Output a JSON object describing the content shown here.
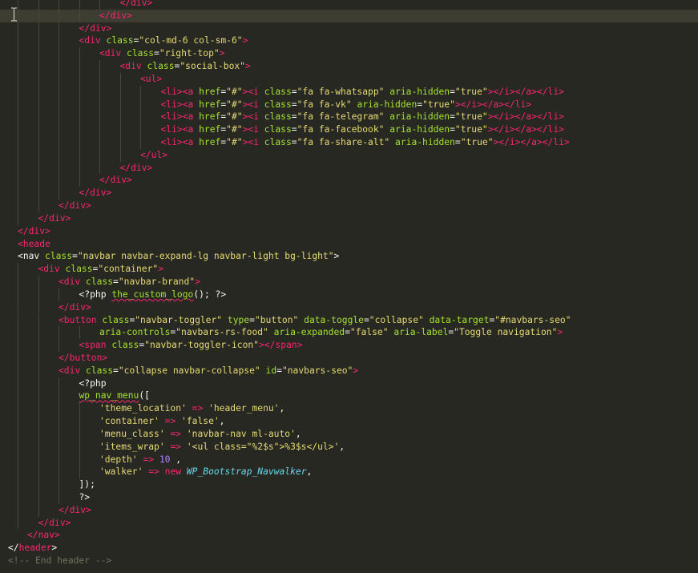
{
  "editor": {
    "theme": "monokai",
    "background": "#272822",
    "current_line_background": "#3e3d32",
    "current_line": 1,
    "colors": {
      "tag": "#f92672",
      "attr": "#a6e22e",
      "string": "#e6db74",
      "number": "#ae81ff",
      "class_name": "#66d9ef",
      "comment": "#75715e",
      "plain": "#f8f8f2"
    },
    "cursor_icon": "text-cursor-icon"
  },
  "lines": [
    {
      "indent": 5,
      "tokens": [
        [
          "tag",
          "</div>"
        ]
      ]
    },
    {
      "indent": 4,
      "tokens": [
        [
          "tag",
          "</div>"
        ]
      ]
    },
    {
      "indent": 3,
      "tokens": [
        [
          "tag",
          "</div>"
        ]
      ]
    },
    {
      "indent": 3,
      "tokens": [
        [
          "tag",
          "<div"
        ],
        [
          "plain",
          " "
        ],
        [
          "attr",
          "class"
        ],
        [
          "plain",
          "="
        ],
        [
          "str",
          "\"col-md-6 col-sm-6\""
        ],
        [
          "tag",
          ">"
        ]
      ]
    },
    {
      "indent": 4,
      "tokens": [
        [
          "tag",
          "<div"
        ],
        [
          "plain",
          " "
        ],
        [
          "attr",
          "class"
        ],
        [
          "plain",
          "="
        ],
        [
          "str",
          "\"right-top\""
        ],
        [
          "tag",
          ">"
        ]
      ]
    },
    {
      "indent": 5,
      "tokens": [
        [
          "tag",
          "<div"
        ],
        [
          "plain",
          " "
        ],
        [
          "attr",
          "class"
        ],
        [
          "plain",
          "="
        ],
        [
          "str",
          "\"social-box\""
        ],
        [
          "tag",
          ">"
        ]
      ]
    },
    {
      "indent": 6,
      "tokens": [
        [
          "tag",
          "<ul>"
        ]
      ]
    },
    {
      "indent": 7,
      "tokens": [
        [
          "tag",
          "<li><a"
        ],
        [
          "plain",
          " "
        ],
        [
          "attr",
          "href"
        ],
        [
          "plain",
          "="
        ],
        [
          "str",
          "\"#\""
        ],
        [
          "tag",
          "><i"
        ],
        [
          "plain",
          " "
        ],
        [
          "attr",
          "class"
        ],
        [
          "plain",
          "="
        ],
        [
          "str",
          "\"fa fa-whatsapp\""
        ],
        [
          "plain",
          " "
        ],
        [
          "attr",
          "aria-hidden"
        ],
        [
          "plain",
          "="
        ],
        [
          "str",
          "\"true\""
        ],
        [
          "tag",
          "></i></a></li>"
        ]
      ]
    },
    {
      "indent": 7,
      "tokens": [
        [
          "tag",
          "<li><a"
        ],
        [
          "plain",
          " "
        ],
        [
          "attr",
          "href"
        ],
        [
          "plain",
          "="
        ],
        [
          "str",
          "\"#\""
        ],
        [
          "tag",
          "><i"
        ],
        [
          "plain",
          " "
        ],
        [
          "attr",
          "class"
        ],
        [
          "plain",
          "="
        ],
        [
          "str",
          "\"fa fa-vk\""
        ],
        [
          "plain",
          " "
        ],
        [
          "attr",
          "aria-hidden"
        ],
        [
          "plain",
          "="
        ],
        [
          "str",
          "\"true\""
        ],
        [
          "tag",
          "></i></a></li>"
        ]
      ]
    },
    {
      "indent": 7,
      "tokens": [
        [
          "tag",
          "<li><a"
        ],
        [
          "plain",
          " "
        ],
        [
          "attr",
          "href"
        ],
        [
          "plain",
          "="
        ],
        [
          "str",
          "\"#\""
        ],
        [
          "tag",
          "><i"
        ],
        [
          "plain",
          " "
        ],
        [
          "attr",
          "class"
        ],
        [
          "plain",
          "="
        ],
        [
          "str",
          "\"fa fa-telegram\""
        ],
        [
          "plain",
          " "
        ],
        [
          "attr",
          "aria-hidden"
        ],
        [
          "plain",
          "="
        ],
        [
          "str",
          "\"true\""
        ],
        [
          "tag",
          "></i></a></li>"
        ]
      ]
    },
    {
      "indent": 7,
      "tokens": [
        [
          "tag",
          "<li><a"
        ],
        [
          "plain",
          " "
        ],
        [
          "attr",
          "href"
        ],
        [
          "plain",
          "="
        ],
        [
          "str",
          "\"#\""
        ],
        [
          "tag",
          "><i"
        ],
        [
          "plain",
          " "
        ],
        [
          "attr",
          "class"
        ],
        [
          "plain",
          "="
        ],
        [
          "str",
          "\"fa fa-facebook\""
        ],
        [
          "plain",
          " "
        ],
        [
          "attr",
          "aria-hidden"
        ],
        [
          "plain",
          "="
        ],
        [
          "str",
          "\"true\""
        ],
        [
          "tag",
          "></i></a></li>"
        ]
      ]
    },
    {
      "indent": 7,
      "tokens": [
        [
          "tag",
          "<li><a"
        ],
        [
          "plain",
          " "
        ],
        [
          "attr",
          "href"
        ],
        [
          "plain",
          "="
        ],
        [
          "str",
          "\"#\""
        ],
        [
          "tag",
          "><i"
        ],
        [
          "plain",
          " "
        ],
        [
          "attr",
          "class"
        ],
        [
          "plain",
          "="
        ],
        [
          "str",
          "\"fa fa-share-alt\""
        ],
        [
          "plain",
          " "
        ],
        [
          "attr",
          "aria-hidden"
        ],
        [
          "plain",
          "="
        ],
        [
          "str",
          "\"true\""
        ],
        [
          "tag",
          "></i></a></li>"
        ]
      ]
    },
    {
      "indent": 6,
      "tokens": [
        [
          "tag",
          "</ul>"
        ]
      ]
    },
    {
      "indent": 5,
      "tokens": [
        [
          "tag",
          "</div>"
        ]
      ]
    },
    {
      "indent": 4,
      "tokens": [
        [
          "tag",
          "</div>"
        ]
      ]
    },
    {
      "indent": 3,
      "tokens": [
        [
          "tag",
          "</div>"
        ]
      ]
    },
    {
      "indent": 2,
      "tokens": [
        [
          "tag",
          "</div>"
        ]
      ]
    },
    {
      "indent": 1,
      "tokens": [
        [
          "tag",
          "</div>"
        ]
      ]
    },
    {
      "indent": 0,
      "tokens": [
        [
          "tag",
          "</div>"
        ]
      ]
    },
    {
      "indent": 0,
      "tokens": [
        [
          "tag",
          "<heade"
        ]
      ]
    },
    {
      "indent": 0,
      "tokens": [
        [
          "plain",
          "<"
        ],
        [
          "plain",
          "nav "
        ],
        [
          "attr",
          "class"
        ],
        [
          "plain",
          "="
        ],
        [
          "str",
          "\"navbar navbar-expand-lg navbar-light bg-light\""
        ],
        [
          "plain",
          ">"
        ]
      ]
    },
    {
      "indent": 1,
      "tokens": [
        [
          "tag",
          "<div"
        ],
        [
          "plain",
          " "
        ],
        [
          "attr",
          "class"
        ],
        [
          "plain",
          "="
        ],
        [
          "str",
          "\"container\""
        ],
        [
          "tag",
          ">"
        ]
      ]
    },
    {
      "indent": 2,
      "tokens": [
        [
          "tag",
          "<div"
        ],
        [
          "plain",
          " "
        ],
        [
          "attr",
          "class"
        ],
        [
          "plain",
          "="
        ],
        [
          "str",
          "\"navbar-brand\""
        ],
        [
          "tag",
          ">"
        ]
      ]
    },
    {
      "indent": 3,
      "tokens": [
        [
          "plain",
          "<?php "
        ],
        [
          "funcsq",
          "the_custom_logo"
        ],
        [
          "plain",
          "(); ?>"
        ]
      ]
    },
    {
      "indent": 2,
      "tokens": [
        [
          "tag",
          "</div>"
        ]
      ]
    },
    {
      "indent": 2,
      "tokens": [
        [
          "tag",
          "<button"
        ],
        [
          "plain",
          " "
        ],
        [
          "attr",
          "class"
        ],
        [
          "plain",
          "="
        ],
        [
          "str",
          "\"navbar-toggler\""
        ],
        [
          "plain",
          " "
        ],
        [
          "attr",
          "type"
        ],
        [
          "plain",
          "="
        ],
        [
          "str",
          "\"button\""
        ],
        [
          "plain",
          " "
        ],
        [
          "attr",
          "data-toggle"
        ],
        [
          "plain",
          "="
        ],
        [
          "str",
          "\"collapse\""
        ],
        [
          "plain",
          " "
        ],
        [
          "attr",
          "data-target"
        ],
        [
          "plain",
          "="
        ],
        [
          "str",
          "\"#navbars-seo\""
        ]
      ]
    },
    {
      "indent": 4,
      "tokens": [
        [
          "attr",
          "aria-controls"
        ],
        [
          "plain",
          "="
        ],
        [
          "str",
          "\"navbars-rs-food\""
        ],
        [
          "plain",
          " "
        ],
        [
          "attr",
          "aria-expanded"
        ],
        [
          "plain",
          "="
        ],
        [
          "str",
          "\"false\""
        ],
        [
          "plain",
          " "
        ],
        [
          "attr",
          "aria-label"
        ],
        [
          "plain",
          "="
        ],
        [
          "str",
          "\"Toggle navigation\""
        ],
        [
          "tag",
          ">"
        ]
      ]
    },
    {
      "indent": 3,
      "tokens": [
        [
          "tag",
          "<span"
        ],
        [
          "plain",
          " "
        ],
        [
          "attr",
          "class"
        ],
        [
          "plain",
          "="
        ],
        [
          "str",
          "\"navbar-toggler-icon\""
        ],
        [
          "tag",
          "></span>"
        ]
      ]
    },
    {
      "indent": 2,
      "tokens": [
        [
          "tag",
          "</button>"
        ]
      ]
    },
    {
      "indent": 2,
      "tokens": [
        [
          "tag",
          "<div"
        ],
        [
          "plain",
          " "
        ],
        [
          "attr",
          "class"
        ],
        [
          "plain",
          "="
        ],
        [
          "str",
          "\"collapse navbar-collapse\""
        ],
        [
          "plain",
          " "
        ],
        [
          "attr",
          "id"
        ],
        [
          "plain",
          "="
        ],
        [
          "str",
          "\"navbars-seo\""
        ],
        [
          "tag",
          ">"
        ]
      ]
    },
    {
      "indent": 3,
      "tokens": [
        [
          "plain",
          "<?php"
        ]
      ]
    },
    {
      "indent": 3,
      "tokens": [
        [
          "funcsq",
          "wp_nav_menu"
        ],
        [
          "plain",
          "(["
        ]
      ]
    },
    {
      "indent": 4,
      "tokens": [
        [
          "str",
          "'theme_location'"
        ],
        [
          "plain",
          " "
        ],
        [
          "op",
          "=>"
        ],
        [
          "plain",
          " "
        ],
        [
          "str",
          "'header_menu'"
        ],
        [
          "plain",
          ","
        ]
      ]
    },
    {
      "indent": 4,
      "tokens": [
        [
          "str",
          "'container'"
        ],
        [
          "plain",
          " "
        ],
        [
          "op",
          "=>"
        ],
        [
          "plain",
          " "
        ],
        [
          "str",
          "'false'"
        ],
        [
          "plain",
          ","
        ]
      ]
    },
    {
      "indent": 4,
      "tokens": [
        [
          "str",
          "'menu_class'"
        ],
        [
          "plain",
          " "
        ],
        [
          "op",
          "=>"
        ],
        [
          "plain",
          " "
        ],
        [
          "str",
          "'navbar-nav ml-auto'"
        ],
        [
          "plain",
          ","
        ]
      ]
    },
    {
      "indent": 4,
      "tokens": [
        [
          "str",
          "'items_wrap'"
        ],
        [
          "plain",
          " "
        ],
        [
          "op",
          "=>"
        ],
        [
          "plain",
          " "
        ],
        [
          "str",
          "'<ul class=\"%2$s\">%3$s</ul>'"
        ],
        [
          "plain",
          ","
        ]
      ]
    },
    {
      "indent": 4,
      "tokens": [
        [
          "str",
          "'depth'"
        ],
        [
          "plain",
          " "
        ],
        [
          "op",
          "=>"
        ],
        [
          "plain",
          " "
        ],
        [
          "num",
          "10"
        ],
        [
          "plain",
          " ,"
        ]
      ]
    },
    {
      "indent": 4,
      "tokens": [
        [
          "str",
          "'walker'"
        ],
        [
          "plain",
          " "
        ],
        [
          "op",
          "=>"
        ],
        [
          "plain",
          " "
        ],
        [
          "kw",
          "new"
        ],
        [
          "plain",
          " "
        ],
        [
          "cls",
          "WP_Bootstrap_Navwalker"
        ],
        [
          "plain",
          ","
        ]
      ]
    },
    {
      "indent": 3,
      "tokens": [
        [
          "plain",
          "]);"
        ]
      ]
    },
    {
      "indent": 3,
      "tokens": [
        [
          "plain",
          "?>"
        ]
      ]
    },
    {
      "indent": 2,
      "tokens": [
        [
          "tag",
          "</div>"
        ]
      ]
    },
    {
      "indent": 1,
      "tokens": [
        [
          "tag",
          "</div>"
        ]
      ]
    },
    {
      "indent": 0,
      "offset": 1,
      "tokens": [
        [
          "tag",
          "</nav>"
        ]
      ]
    },
    {
      "indent": 0,
      "offset": -1,
      "tokens": [
        [
          "plain",
          "</"
        ],
        [
          "tag",
          "header"
        ],
        [
          "plain",
          ">"
        ]
      ]
    },
    {
      "indent": 0,
      "offset": -1,
      "tokens": [
        [
          "comment",
          "<!-- End header -->"
        ]
      ]
    }
  ]
}
